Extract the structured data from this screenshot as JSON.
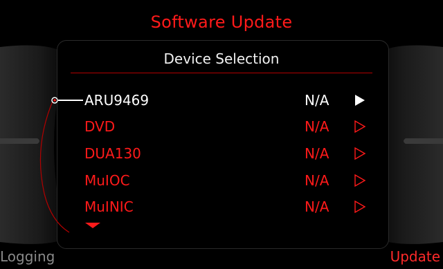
{
  "header": {
    "title": "Software Update"
  },
  "panel": {
    "subtitle": "Device Selection"
  },
  "devices": [
    {
      "name": "ARU9469",
      "status": "N/A",
      "selected": true
    },
    {
      "name": "DVD",
      "status": "N/A",
      "selected": false
    },
    {
      "name": "DUA130",
      "status": "N/A",
      "selected": false
    },
    {
      "name": "MuIOC",
      "status": "N/A",
      "selected": false
    },
    {
      "name": "MuINIC",
      "status": "N/A",
      "selected": false
    }
  ],
  "softkeys": {
    "left": "Logging",
    "right": "Update"
  },
  "colors": {
    "accent": "#ff1a1a",
    "selected_text": "#ffffff",
    "inactive_softkey": "#8a8a8a",
    "background": "#000000"
  },
  "icons": {
    "selection_indicator": "circle-pointer-icon",
    "row_arrow": "play-arrow-icon",
    "scroll_more": "triangle-down-icon"
  }
}
